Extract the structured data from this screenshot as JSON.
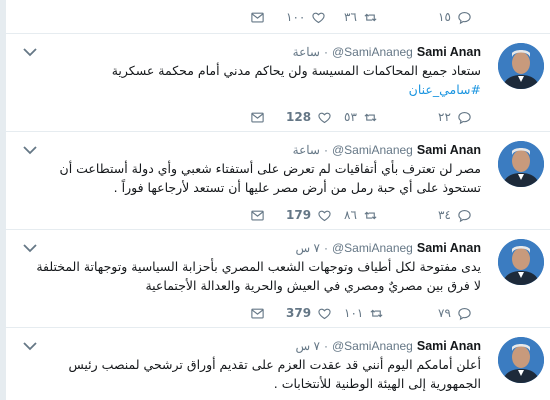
{
  "colors": {
    "link": "#1b95e0",
    "muted": "#657786",
    "border": "#e6ecf0"
  },
  "top_actions": {
    "reply_count": "١٥",
    "retweet_count": "٣٦",
    "like_count": "١٠٠"
  },
  "tweets": [
    {
      "name": "Sami Anan",
      "handle": "@SamiAnaneg",
      "dot": "·",
      "time": "ساعة",
      "text_lines": [
        "ستعاد جميع المحاكمات المسيسة ولن يحاكم مدني أمام محكمة عسكرية"
      ],
      "hashtag": "#سامي_عنان",
      "reply_count": "٢٢",
      "retweet_count": "٥٣",
      "like_count": "128"
    },
    {
      "name": "Sami Anan",
      "handle": "@SamiAnaneg",
      "dot": "·",
      "time": "ساعة",
      "text_lines": [
        "مصر لن تعترف بأي أتفاقيات لم تعرض على أستفتاء شعبي وأي دولة أستطاعت أن",
        "تستحوذ على أي حبة رمل من أرض مصر عليها أن تستعد لأرجاعها فوراً ."
      ],
      "reply_count": "٣٤",
      "retweet_count": "٨٦",
      "like_count": "179"
    },
    {
      "name": "Sami Anan",
      "handle": "@SamiAnaneg",
      "dot": "·",
      "time": "٧ س",
      "text_lines": [
        "يدى مفتوحة لكل أطياف وتوجهات الشعب المصري بأحزابة السياسية وتوجهاتة المختلفة",
        "لا فرق بين مصريٌ ومصري في العيش والحرية والعدالة الأجتماعية"
      ],
      "reply_count": "٧٩",
      "retweet_count": "١٠١",
      "like_count": "379"
    },
    {
      "name": "Sami Anan",
      "handle": "@SamiAnaneg",
      "dot": "·",
      "time": "٧ س",
      "text_lines": [
        "أعلن أمامكم اليوم أنني قد عقدت العزم على تقديم أوراق ترشحي لمنصب رئيس",
        "الجمهورية إلى الهيئة الوطنية للأنتخابات ."
      ]
    }
  ]
}
